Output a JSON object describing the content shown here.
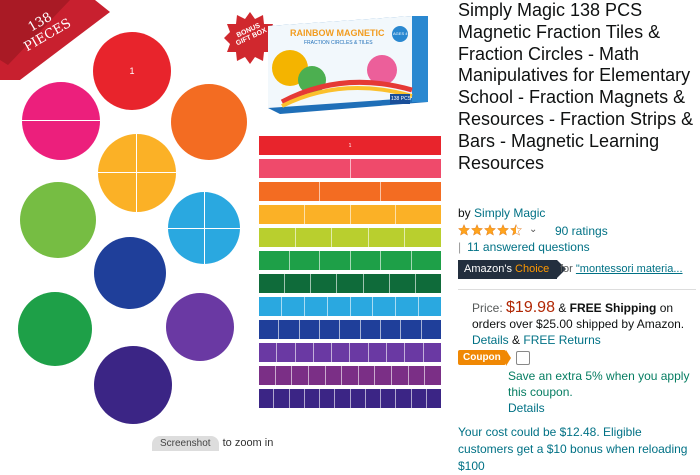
{
  "product": {
    "title": "Simply Magic 138 PCS Magnetic Fraction Tiles & Fraction Circles - Math Manipulatives for Elementary School - Fraction Magnets & Resources - Fraction Strips & Bars - Magnetic Learning Resources",
    "by_label": "by",
    "brand": "Simply Magic",
    "rating_stars": 4.5,
    "ratings_count": "90 ratings",
    "answered_questions": "11 answered questions",
    "choice_badge": {
      "prefix": "Amazon's",
      "word": "Choice"
    },
    "choice_for_label": "for",
    "choice_for_query": "\"montessori materia..."
  },
  "pricing": {
    "price_label": "Price:",
    "price": "$19.98",
    "amp": "&",
    "free_shipping": "FREE Shipping",
    "shipping_rest": "on orders over $25.00 shipped by Amazon.",
    "details_link": "Details",
    "amp2": "&",
    "free_returns": "FREE Returns"
  },
  "coupon": {
    "badge": "Coupon",
    "text": "Save an extra 5% when you apply this coupon.",
    "details": "Details"
  },
  "cost_line": "Your cost could be $12.48. Eligible customers get a $10 bonus when reloading $100",
  "image": {
    "ribbon_text_line1": "138",
    "ribbon_text_line2": "PIECES",
    "gift_line1": "BONUS",
    "gift_line2": "GIFT BOX",
    "box_title": "RAINBOW MAGNETIC",
    "box_subtitle": "FRACTION CIRCLES & TILES",
    "box_badge": "138 PCS",
    "box_age": "AGES 4+",
    "zoom_pill": "Screenshot",
    "zoom_hint": "to zoom in"
  },
  "colors": {
    "link": "#007185",
    "price": "#b12704",
    "coupon": "#f08804",
    "coupon_text": "#067d62",
    "choice_bg": "#232f3e"
  }
}
